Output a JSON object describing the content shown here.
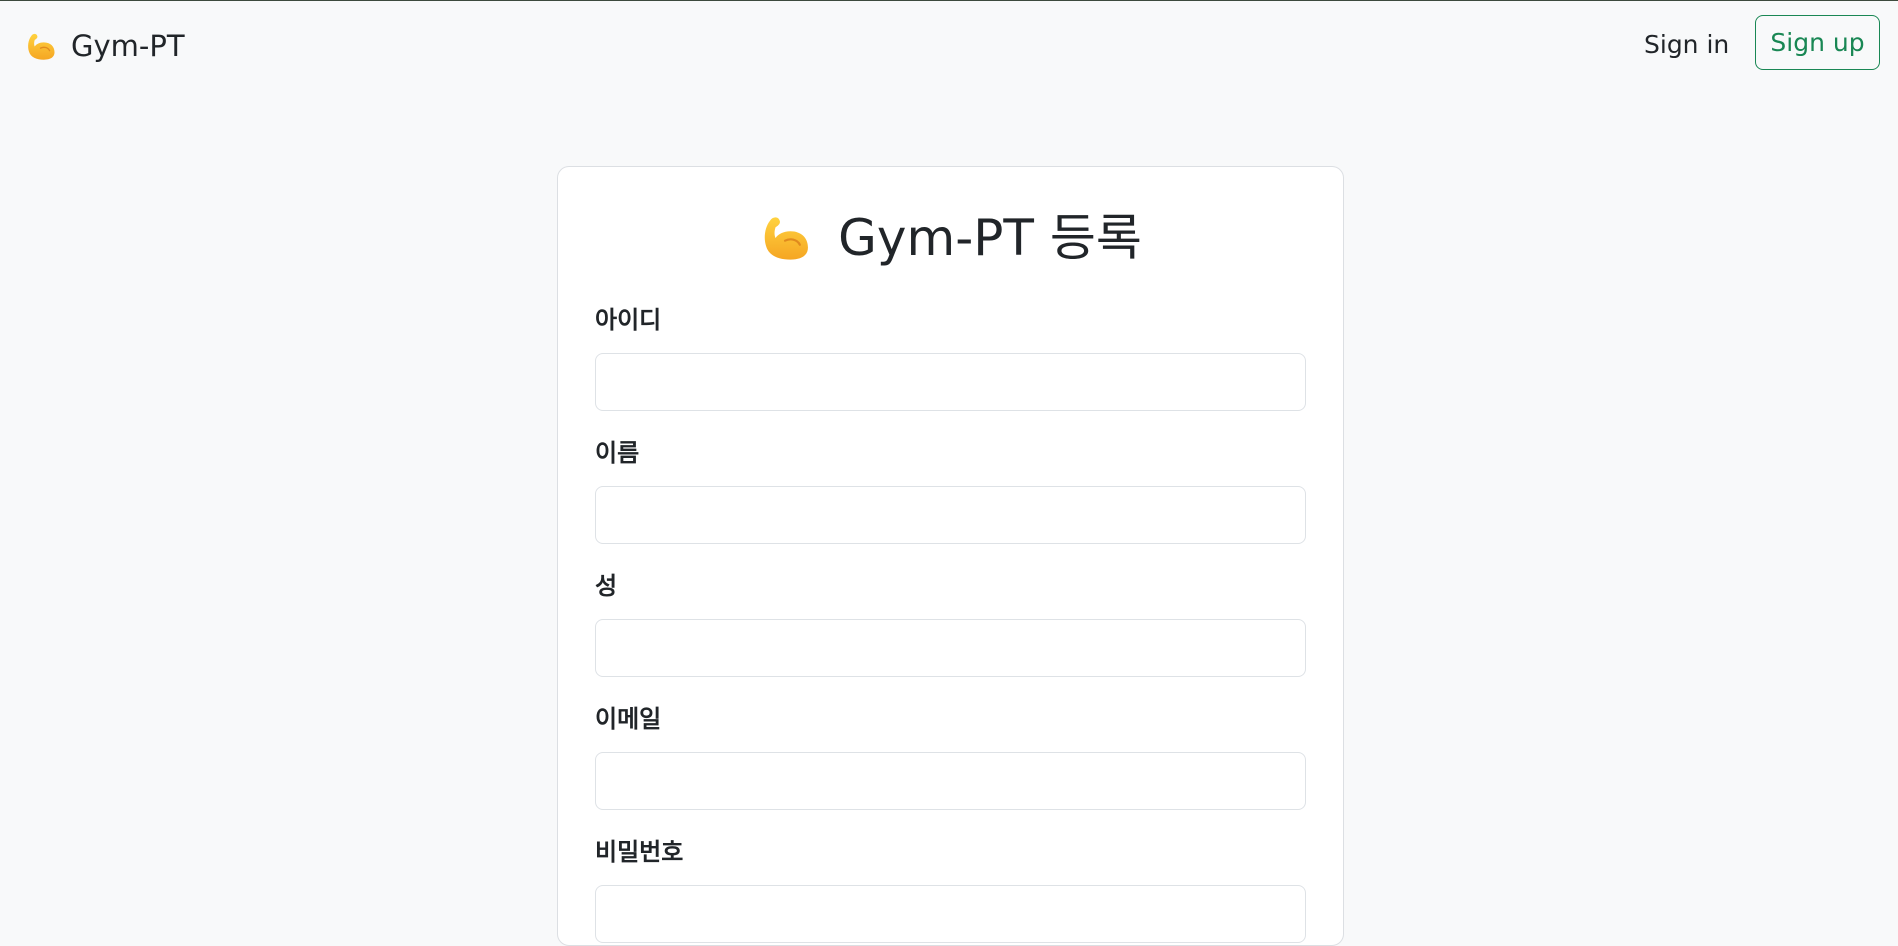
{
  "navbar": {
    "brand_label": "Gym-PT",
    "brand_icon": "flexed-biceps-icon",
    "signin_label": "Sign in",
    "signup_label": "Sign up",
    "accent_color": "#198754"
  },
  "form": {
    "title": "Gym-PT 등록",
    "title_icon": "flexed-biceps-icon",
    "fields": [
      {
        "label": "아이디",
        "value": "",
        "placeholder": ""
      },
      {
        "label": "이름",
        "value": "",
        "placeholder": ""
      },
      {
        "label": "성",
        "value": "",
        "placeholder": ""
      },
      {
        "label": "이메일",
        "value": "",
        "placeholder": ""
      },
      {
        "label": "비밀번호",
        "value": "",
        "placeholder": ""
      }
    ]
  }
}
